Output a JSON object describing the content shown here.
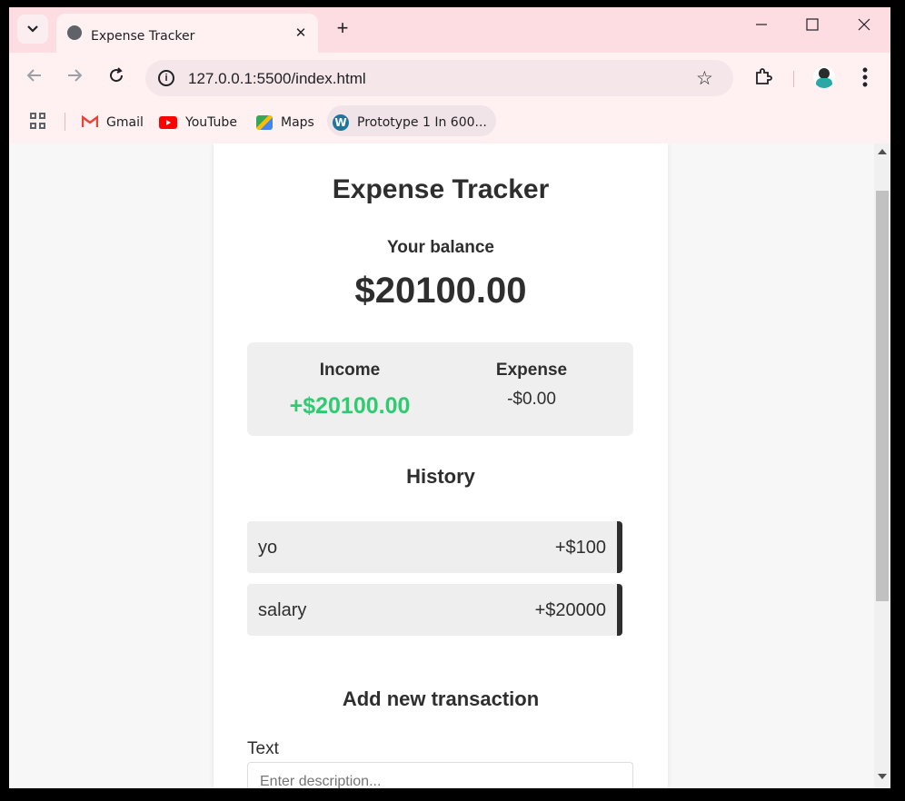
{
  "browser": {
    "tab_title": "Expense Tracker",
    "tab_close": "✕",
    "new_tab": "+",
    "url": "127.0.0.1:5500/index.html",
    "bookmarks": [
      {
        "label": "Gmail",
        "icon": "gmail-icon",
        "color": "#ea4335"
      },
      {
        "label": "YouTube",
        "icon": "youtube-icon",
        "color": "#ff0000"
      },
      {
        "label": "Maps",
        "icon": "maps-icon",
        "color": "#34a853"
      },
      {
        "label": "Prototype 1 In 600...",
        "icon": "wordpress-icon",
        "color": "#21759b"
      }
    ]
  },
  "app": {
    "title": "Expense Tracker",
    "balance_label": "Your balance",
    "balance": "$20100.00",
    "income_label": "Income",
    "income": "+$20100.00",
    "expense_label": "Expense",
    "expense": "-$0.00",
    "history_title": "History",
    "history": [
      {
        "text": "yo",
        "amount": "+$100"
      },
      {
        "text": "salary",
        "amount": "+$20000"
      }
    ],
    "add_title": "Add new transaction",
    "text_label": "Text",
    "text_placeholder": "Enter description..."
  },
  "colors": {
    "income": "#2ecc71",
    "text": "#2e2e2e",
    "tab_strip": "#fddde2"
  }
}
